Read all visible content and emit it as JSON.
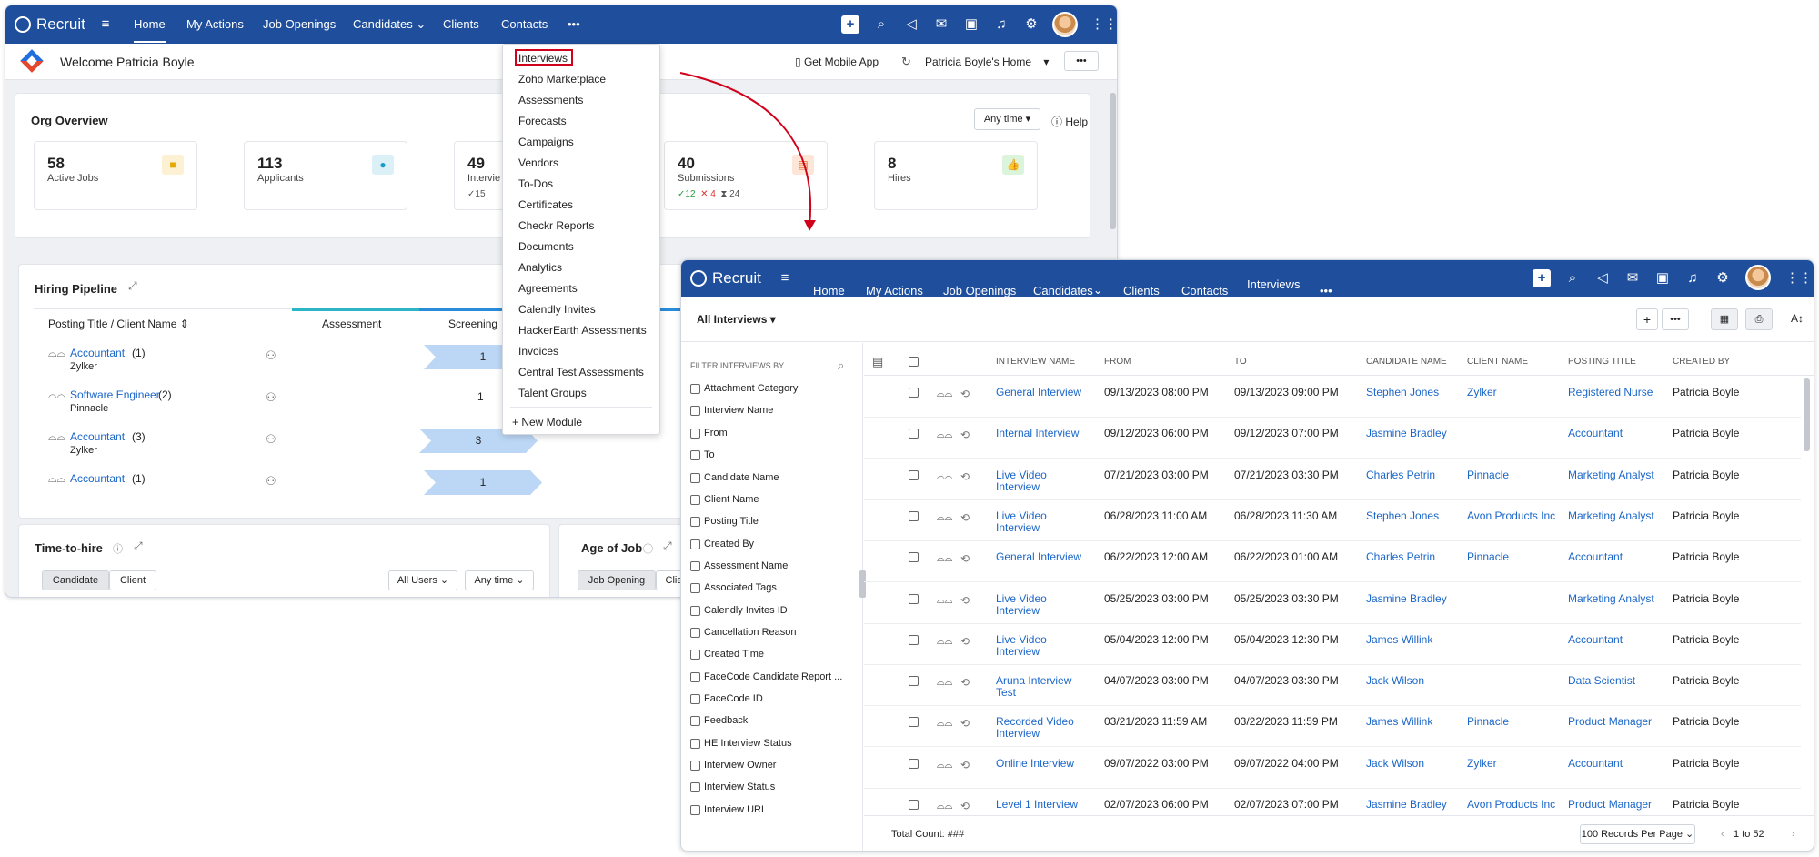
{
  "w1": {
    "app": "Recruit",
    "nav": [
      "Home",
      "My Actions",
      "Job Openings",
      "Candidates",
      "Clients",
      "Contacts",
      "•••"
    ],
    "welcome": "Welcome Patricia Boyle",
    "mobile": "Get Mobile App",
    "home_sel": "Patricia Boyle's Home",
    "org_title": "Org Overview",
    "anytime": "Any time",
    "help": "Help",
    "kpis": [
      {
        "num": "58",
        "label": "Active Jobs"
      },
      {
        "num": "113",
        "label": "Applicants"
      },
      {
        "num": "49",
        "label": "Intervie"
      },
      {
        "num": "40",
        "label": "Submissions"
      },
      {
        "num": "8",
        "label": "Hires"
      }
    ],
    "kpi_sub_interviews": "✓15",
    "kpi_sub_submissions": [
      "✓12",
      "✕ 4",
      "⧗ 24"
    ],
    "pipeline_title": "Hiring Pipeline",
    "pipeline_col": "Posting Title / Client Name",
    "pipeline_stages": [
      "Assessment",
      "Screening"
    ],
    "pipeline_rows": [
      {
        "title": "Accountant",
        "count": "(1)",
        "client": "Zylker",
        "stage_val": "1"
      },
      {
        "title": "Software Engineer",
        "count": "(2)",
        "client": "Pinnacle",
        "stage_val": "1"
      },
      {
        "title": "Accountant",
        "count": "(3)",
        "client": "Zylker",
        "stage_val": "3"
      },
      {
        "title": "Accountant",
        "count": "(1)",
        "client": "",
        "stage_val": "1"
      }
    ],
    "tth_title": "Time-to-hire",
    "tth_tabs": [
      "Candidate",
      "Client"
    ],
    "all_users": "All Users",
    "any_time2": "Any time",
    "age_title": "Age of Job",
    "age_tabs": [
      "Job Opening",
      "Clie"
    ]
  },
  "menu": {
    "items": [
      "Interviews",
      "Zoho Marketplace",
      "Assessments",
      "Forecasts",
      "Campaigns",
      "Vendors",
      "To-Dos",
      "Certificates",
      "Checkr Reports",
      "Documents",
      "Analytics",
      "Agreements",
      "Calendly Invites",
      "HackerEarth Assessments",
      "Invoices",
      "Central Test Assessments",
      "Talent Groups"
    ],
    "new_module": "+ New Module"
  },
  "w2": {
    "app": "Recruit",
    "nav": [
      "Home",
      "My Actions",
      "Job Openings",
      "Candidates",
      "Clients",
      "Contacts",
      "Interviews",
      "•••"
    ],
    "view": "All Interviews",
    "filter_title": "FILTER INTERVIEWS BY",
    "filters": [
      "Attachment Category",
      "Interview Name",
      "From",
      "To",
      "Candidate Name",
      "Client Name",
      "Posting Title",
      "Created By",
      "Assessment Name",
      "Associated Tags",
      "Calendly Invites ID",
      "Cancellation Reason",
      "Created Time",
      "FaceCode Candidate Report ...",
      "FaceCode ID",
      "Feedback",
      "HE Interview Status",
      "Interview Owner",
      "Interview Status",
      "Interview URL"
    ],
    "columns": [
      "Interview Name",
      "From",
      "To",
      "Candidate Name",
      "Client Name",
      "Posting Title",
      "Created By"
    ],
    "rows": [
      {
        "name": "General Interview",
        "from": "09/13/2023 08:00 PM",
        "to": "09/13/2023 09:00 PM",
        "cand": "Stephen Jones",
        "client": "Zylker",
        "post": "Registered Nurse",
        "by": "Patricia Boyle"
      },
      {
        "name": "Internal Interview",
        "from": "09/12/2023 06:00 PM",
        "to": "09/12/2023 07:00 PM",
        "cand": "Jasmine Bradley",
        "client": "",
        "post": "Accountant",
        "by": "Patricia Boyle"
      },
      {
        "name": "Live Video Interview",
        "from": "07/21/2023 03:00 PM",
        "to": "07/21/2023 03:30 PM",
        "cand": "Charles Petrin",
        "client": "Pinnacle",
        "post": "Marketing Analyst",
        "by": "Patricia Boyle"
      },
      {
        "name": "Live Video Interview",
        "from": "06/28/2023 11:00 AM",
        "to": "06/28/2023 11:30 AM",
        "cand": "Stephen Jones",
        "client": "Avon Products Inc",
        "post": "Marketing Analyst",
        "by": "Patricia Boyle"
      },
      {
        "name": "General Interview",
        "from": "06/22/2023 12:00 AM",
        "to": "06/22/2023 01:00 AM",
        "cand": "Charles Petrin",
        "client": "Pinnacle",
        "post": "Accountant",
        "by": "Patricia Boyle"
      },
      {
        "name": "Live Video Interview",
        "from": "05/25/2023 03:00 PM",
        "to": "05/25/2023 03:30 PM",
        "cand": "Jasmine Bradley",
        "client": "",
        "post": "Marketing Analyst",
        "by": "Patricia Boyle"
      },
      {
        "name": "Live Video Interview",
        "from": "05/04/2023 12:00 PM",
        "to": "05/04/2023 12:30 PM",
        "cand": "James Willink",
        "client": "",
        "post": "Accountant",
        "by": "Patricia Boyle"
      },
      {
        "name": "Aruna Interview Test",
        "from": "04/07/2023 03:00 PM",
        "to": "04/07/2023 03:30 PM",
        "cand": "Jack Wilson",
        "client": "",
        "post": "Data Scientist",
        "by": "Patricia Boyle"
      },
      {
        "name": "Recorded Video Interview",
        "from": "03/21/2023 11:59 AM",
        "to": "03/22/2023 11:59 PM",
        "cand": "James Willink",
        "client": "Pinnacle",
        "post": "Product Manager",
        "by": "Patricia Boyle"
      },
      {
        "name": "Online Interview",
        "from": "09/07/2022 03:00 PM",
        "to": "09/07/2022 04:00 PM",
        "cand": "Jack Wilson",
        "client": "Zylker",
        "post": "Accountant",
        "by": "Patricia Boyle"
      },
      {
        "name": "Level 1 Interview",
        "from": "02/07/2023 06:00 PM",
        "to": "02/07/2023 07:00 PM",
        "cand": "Jasmine Bradley",
        "client": "Avon Products Inc",
        "post": "Product Manager",
        "by": "Patricia Boyle"
      }
    ],
    "total": "Total Count: ###",
    "per_page": "100 Records Per Page",
    "pager": "1 to 52"
  },
  "colors": {
    "brand": "#1f4f9c",
    "link": "#1a66c9",
    "arrow": "#d0021b"
  }
}
